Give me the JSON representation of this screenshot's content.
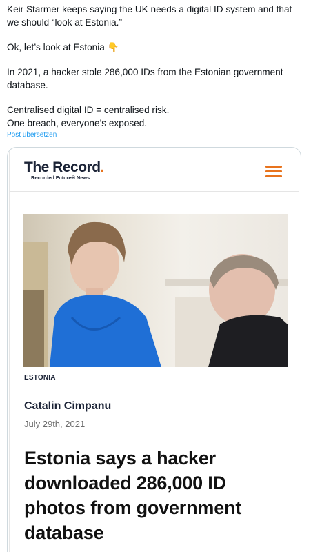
{
  "post": {
    "line1": "Keir Starmer keeps saying the UK needs a digital ID system and that we should “look at Estonia.”",
    "line2": "Ok, let’s look at Estonia 👇",
    "line3": "In 2021, a hacker stole 286,000 IDs from the Estonian government database.",
    "line4": "Centralised digital ID = centralised risk.",
    "line5": "One breach, everyone’s exposed.",
    "translate_label": "Post übersetzen"
  },
  "article": {
    "site_name": "The Record",
    "site_dot": ".",
    "site_tagline": "Recorded Future® News",
    "menu_icon": "hamburger-menu-icon",
    "tag": "ESTONIA",
    "author": "Catalin Cimpanu",
    "date": "July 29th, 2021",
    "headline": "Estonia says a hacker downloaded 286,000 ID photos from government database"
  },
  "colors": {
    "accent": "#e8731d",
    "link": "#1d9bf0",
    "navy": "#1b2336",
    "photo_dress": "#1f6fd6"
  }
}
